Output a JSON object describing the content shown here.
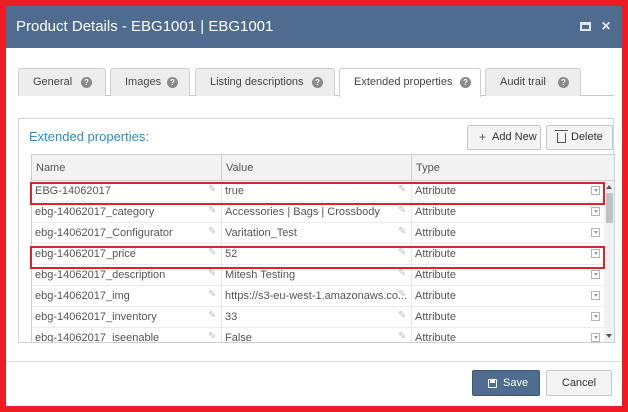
{
  "dialog": {
    "title": "Product Details - EBG1001 | EBG1001",
    "maximize_icon": "maximize-icon",
    "close_icon": "close-icon",
    "close_glyph": "×"
  },
  "tabs": [
    {
      "label": "General",
      "active": false
    },
    {
      "label": "Images",
      "active": false
    },
    {
      "label": "Listing descriptions",
      "active": false
    },
    {
      "label": "Extended properties",
      "active": true
    },
    {
      "label": "Audit trail",
      "active": false
    }
  ],
  "help_glyph": "?",
  "panel": {
    "title": "Extended properties:",
    "add_button": {
      "label": "Add New",
      "icon": "plus-icon",
      "glyph": "+"
    },
    "delete_button": {
      "label": "Delete",
      "icon": "trash-icon"
    }
  },
  "grid": {
    "columns": [
      "Name",
      "Value",
      "Type"
    ],
    "edit_glyph": "✎",
    "rows": [
      {
        "name": "EBG-14062017",
        "value": "true",
        "type": "Attribute",
        "highlighted": true
      },
      {
        "name": "ebg-14062017_category",
        "value": "Accessories | Bags | Crossbody",
        "type": "Attribute",
        "highlighted": false
      },
      {
        "name": "ebg-14062017_Configurator",
        "value": "Varitation_Test",
        "type": "Attribute",
        "highlighted": false
      },
      {
        "name": "ebg-14062017_price",
        "value": "52",
        "type": "Attribute",
        "highlighted": true
      },
      {
        "name": "ebg-14062017_description",
        "value": "Mitesh Testing",
        "type": "Attribute",
        "highlighted": false
      },
      {
        "name": "ebg-14062017_img",
        "value": "https://s3-eu-west-1.amazonaws.co...",
        "type": "Attribute",
        "highlighted": false
      },
      {
        "name": "ebg-14062017_inventory",
        "value": "33",
        "type": "Attribute",
        "highlighted": false
      },
      {
        "name": "ebg-14062017_iseenable",
        "value": "False",
        "type": "Attribute",
        "highlighted": false
      }
    ]
  },
  "footer": {
    "save_label": "Save",
    "save_icon": "save-icon",
    "cancel_label": "Cancel"
  },
  "colors": {
    "titlebar": "#4f6b8f",
    "accent_text": "#2e8bc0",
    "highlight_border": "#d9232d",
    "outer_frame": "#ec1c24"
  }
}
